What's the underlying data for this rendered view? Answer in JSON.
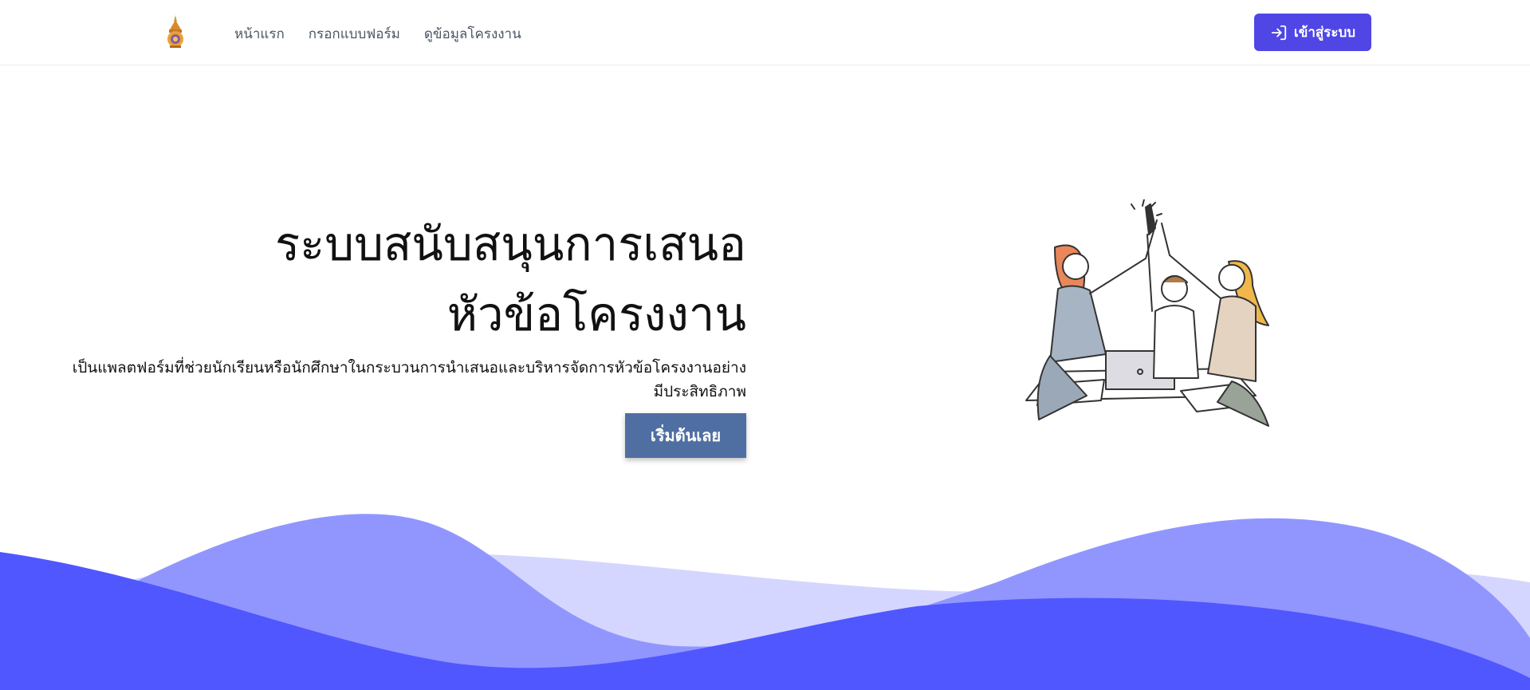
{
  "nav": {
    "links": [
      {
        "label": "หน้าแรก"
      },
      {
        "label": "กรอกแบบฟอร์ม"
      },
      {
        "label": "ดูข้อมูลโครงงาน"
      }
    ],
    "login_label": "เข้าสู่ระบบ"
  },
  "hero": {
    "title_line1": "ระบบสนับสนุนการเสนอ",
    "title_line2": "หัวข้อโครงงาน",
    "description": "เป็นแพลตฟอร์มที่ช่วยนักเรียนหรือนักศึกษาในกระบวนการนำเสนอและบริหารจัดการหัวข้อโครงงานอย่างมีประสิทธิภาพ",
    "cta_label": "เริ่มต้นเลย"
  },
  "icons": {
    "logo": "university-emblem-icon",
    "login": "sign-in-icon",
    "illustration": "team-high-five-illustration"
  },
  "colors": {
    "primary": "#4f46e5",
    "cta": "#4f6fa3",
    "wave_light": "#d4d6ff",
    "wave_mid": "#9196ff",
    "wave_dark": "#5057ff"
  }
}
